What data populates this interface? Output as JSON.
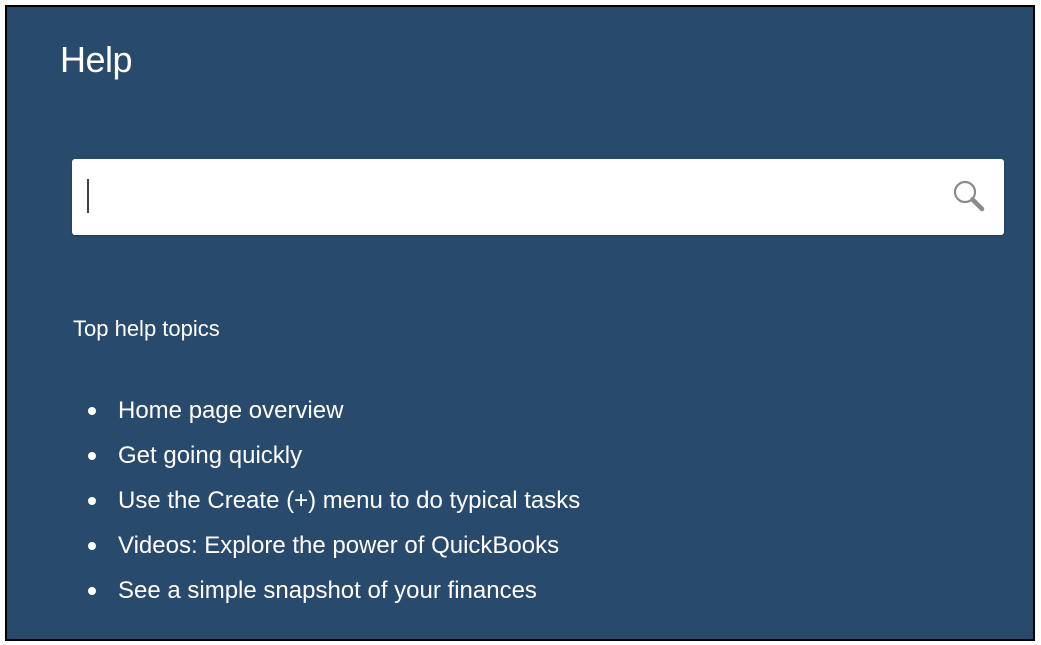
{
  "help_panel": {
    "title": "Help",
    "search": {
      "value": "",
      "placeholder": "",
      "icon": "search-icon"
    },
    "topics_heading": "Top help topics",
    "topics": [
      {
        "label": "Home page overview"
      },
      {
        "label": "Get going quickly"
      },
      {
        "label": "Use the Create (+) menu to do typical tasks"
      },
      {
        "label": "Videos: Explore the power of QuickBooks"
      },
      {
        "label": "See a simple snapshot of your finances"
      }
    ],
    "colors": {
      "panel_background": "#284b6d",
      "text": "#ffffff",
      "search_background": "#ffffff"
    }
  }
}
